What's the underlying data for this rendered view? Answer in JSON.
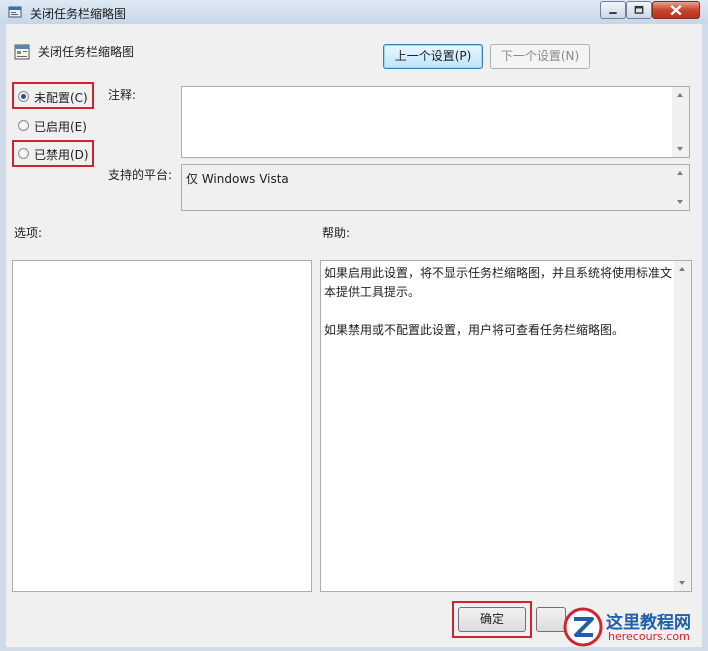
{
  "window": {
    "title": "关闭任务栏缩略图",
    "controls": [
      "minimize",
      "maximize",
      "close"
    ]
  },
  "header": {
    "policy_name": "关闭任务栏缩略图",
    "prev_label": "上一个设置(P)",
    "next_label": "下一个设置(N)"
  },
  "state": {
    "options": [
      {
        "label": "未配置(C)",
        "selected": true,
        "highlighted": true
      },
      {
        "label": "已启用(E)",
        "selected": false,
        "highlighted": false
      },
      {
        "label": "已禁用(D)",
        "selected": false,
        "highlighted": true
      }
    ]
  },
  "fields": {
    "comment_label": "注释:",
    "comment_value": "",
    "platform_label": "支持的平台:",
    "platform_value": "仅 Windows Vista"
  },
  "panes": {
    "options_label": "选项:",
    "help_label": "帮助:",
    "help_paragraphs": [
      "如果启用此设置，将不显示任务栏缩略图，并且系统将使用标准文本提供工具提示。",
      "如果禁用或不配置此设置，用户将可查看任务栏缩略图。"
    ]
  },
  "footer": {
    "ok_label": "确定"
  },
  "watermark": {
    "brand": "这里教程网",
    "url": "herecours.com"
  },
  "colors": {
    "highlight_red": "#d3232f",
    "title_bg": "#cfdbe9",
    "close_red": "#c7452d",
    "focus_blue": "#3c7fb1"
  }
}
